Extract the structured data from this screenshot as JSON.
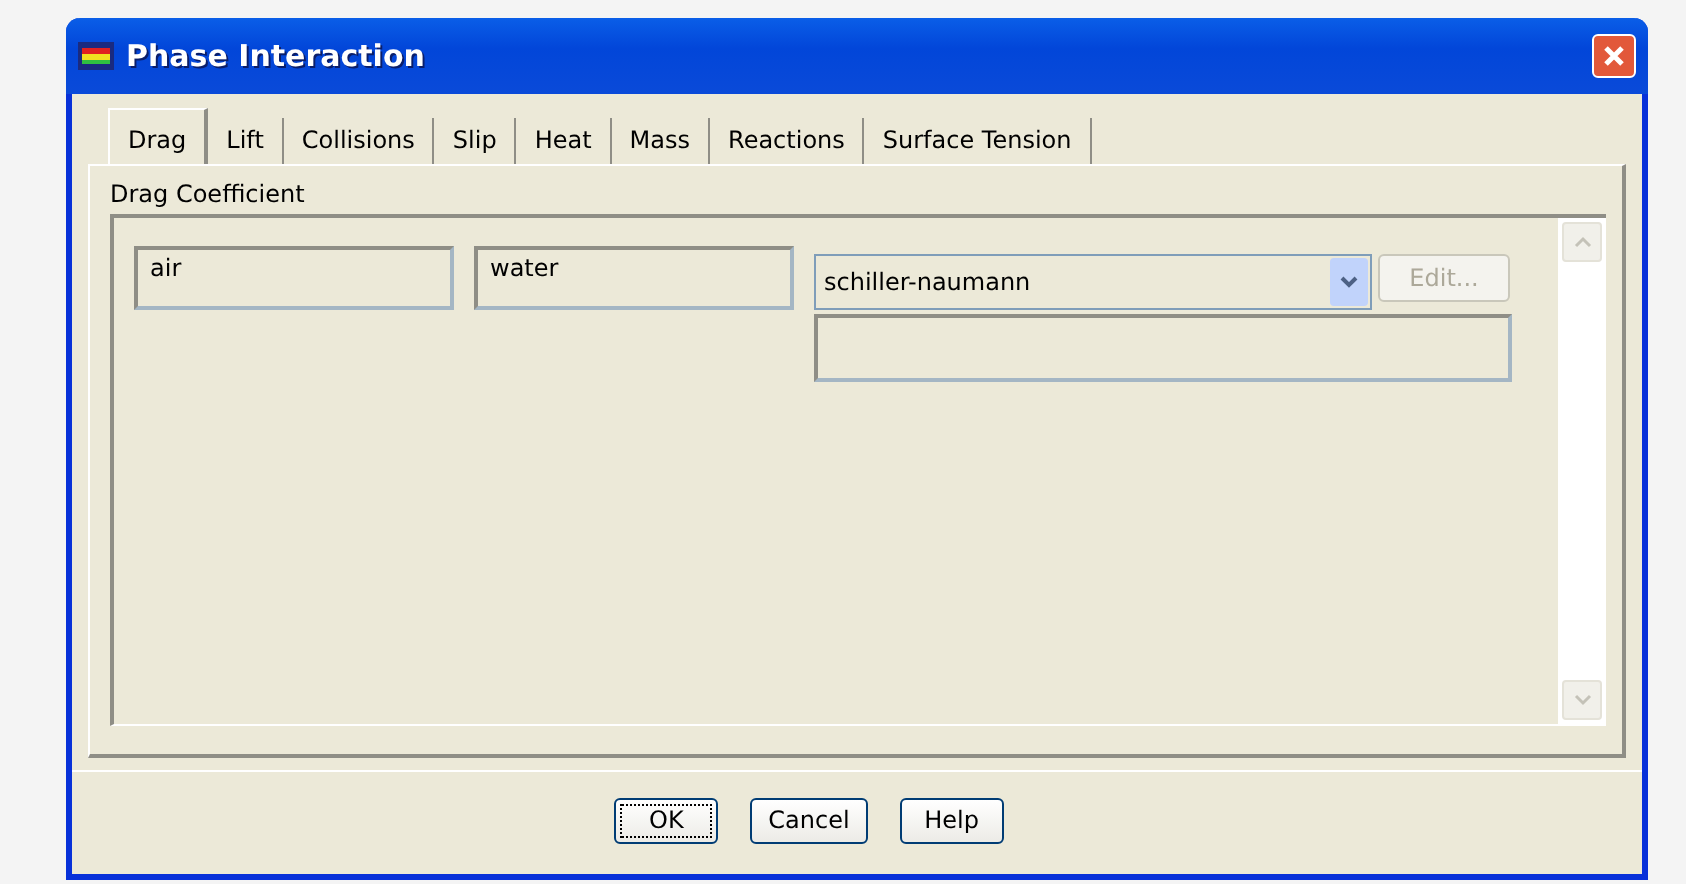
{
  "window": {
    "title": "Phase Interaction"
  },
  "tabs": [
    {
      "label": "Drag",
      "selected": true
    },
    {
      "label": "Lift",
      "selected": false
    },
    {
      "label": "Collisions",
      "selected": false
    },
    {
      "label": "Slip",
      "selected": false
    },
    {
      "label": "Heat",
      "selected": false
    },
    {
      "label": "Mass",
      "selected": false
    },
    {
      "label": "Reactions",
      "selected": false
    },
    {
      "label": "Surface Tension",
      "selected": false
    }
  ],
  "panel": {
    "heading": "Drag Coefficient",
    "phases": [
      "air",
      "water"
    ],
    "method": {
      "value": "schiller-naumann"
    },
    "edit_button": {
      "label": "Edit...",
      "disabled": true
    }
  },
  "buttons": [
    {
      "label": "OK",
      "focused": true
    },
    {
      "label": "Cancel",
      "focused": false
    },
    {
      "label": "Help",
      "focused": false
    }
  ]
}
